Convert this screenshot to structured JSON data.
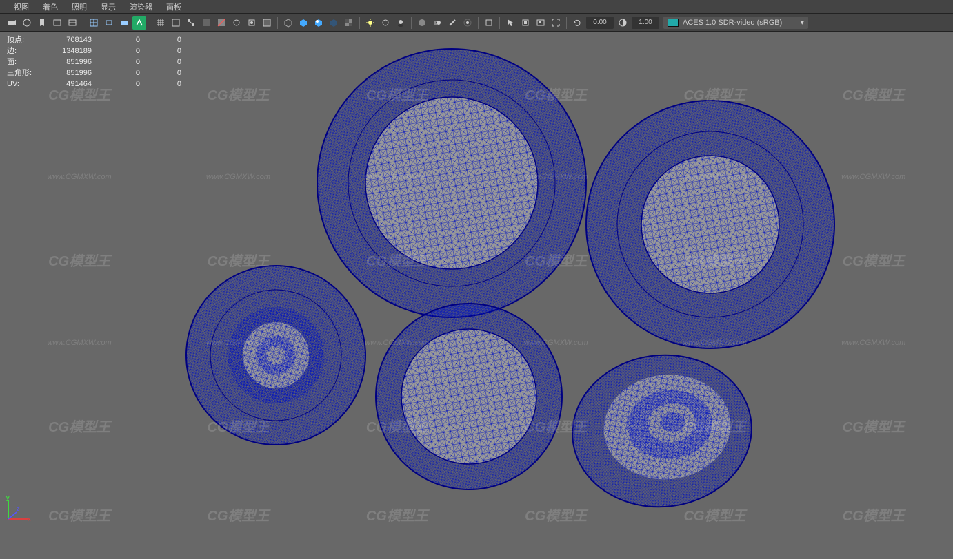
{
  "menus": {
    "view": "视图",
    "shading": "着色",
    "lighting": "照明",
    "show": "显示",
    "renderer": "渲染器",
    "panels": "面板"
  },
  "toolbar": {
    "num1": "0.00",
    "num2": "1.00",
    "colorspace": "ACES 1.0 SDR-video (sRGB)"
  },
  "hud": {
    "rows": [
      {
        "label": "顶点:",
        "c1": "708143",
        "c2": "0",
        "c3": "0"
      },
      {
        "label": "边:",
        "c1": "1348189",
        "c2": "0",
        "c3": "0"
      },
      {
        "label": "面:",
        "c1": "851996",
        "c2": "0",
        "c3": "0"
      },
      {
        "label": "三角形:",
        "c1": "851996",
        "c2": "0",
        "c3": "0"
      },
      {
        "label": "UV:",
        "c1": "491464",
        "c2": "0",
        "c3": "0"
      }
    ]
  },
  "watermark": {
    "logo": "CG模型王",
    "url": "www.CGMXW.com"
  },
  "axis": {
    "x": "x",
    "y": "y",
    "z": "z"
  }
}
